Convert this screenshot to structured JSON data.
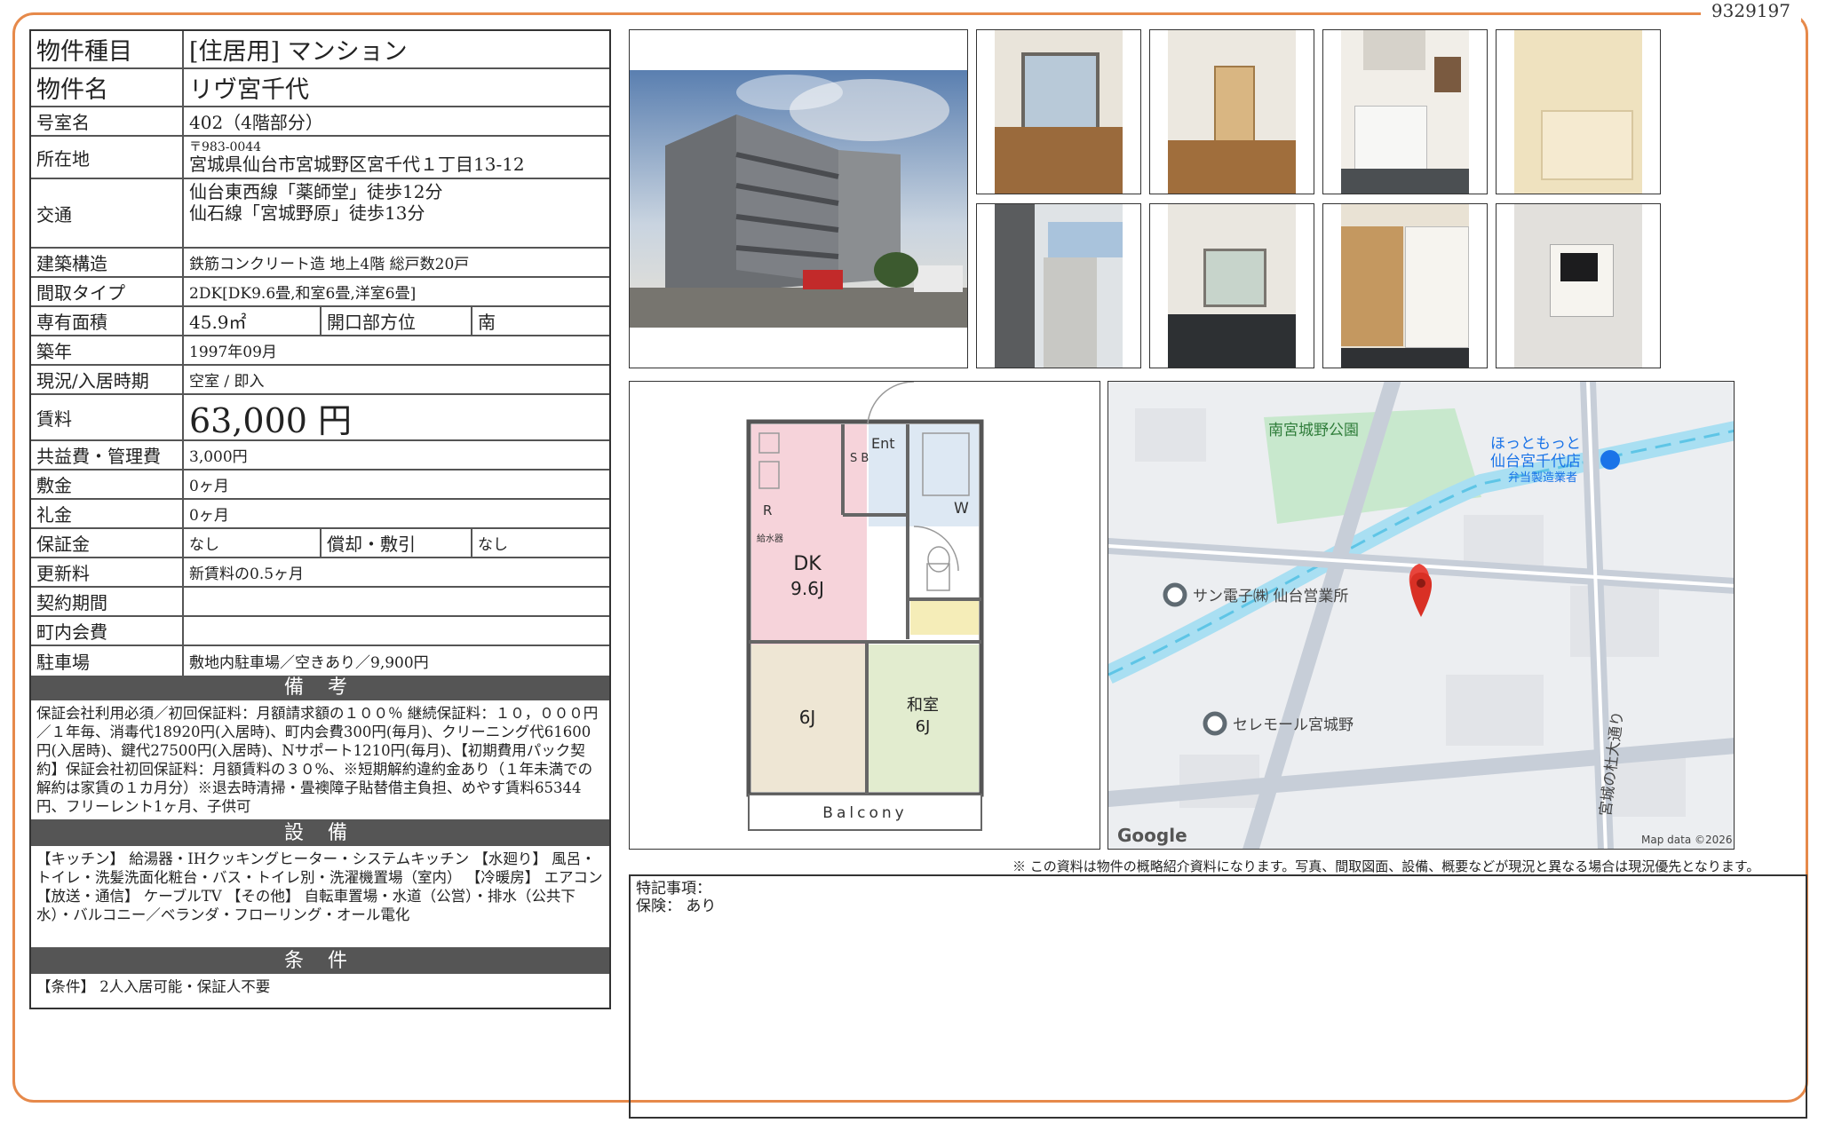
{
  "doc_number": "9329197",
  "property": {
    "type_label": "物件種目",
    "type_value": "[住居用] マンション",
    "name_label": "物件名",
    "name_value": "リヴ宮千代",
    "room_label": "号室名",
    "room_value": "402（4階部分）",
    "address_label": "所在地",
    "postal": "〒983-0044",
    "address_value": "宮城県仙台市宮城野区宮千代１丁目13-12",
    "transit_label": "交通",
    "transit_1": "仙台東西線「薬師堂」徒歩12分",
    "transit_2": "仙石線「宮城野原」徒歩13分",
    "structure_label": "建築構造",
    "structure_value": "鉄筋コンクリート造 地上4階 総戸数20戸",
    "layout_label": "間取タイプ",
    "layout_value": "2DK[DK9.6畳,和室6畳,洋室6畳]",
    "area_label": "専有面積",
    "area_value": "45.9㎡",
    "direction_label": "開口部方位",
    "direction_value": "南",
    "built_label": "築年",
    "built_value": "1997年09月",
    "status_label": "現況/入居時期",
    "status_value": "空室 / 即入",
    "rent_label": "賃料",
    "rent_value": "63,000 円",
    "fee_label": "共益費・管理費",
    "fee_value": "3,000円",
    "deposit_label": "敷金",
    "deposit_value": "0ヶ月",
    "key_money_label": "礼金",
    "key_money_value": "0ヶ月",
    "guarantee_label": "保証金",
    "guarantee_value": "なし",
    "amort_label": "償却・敷引",
    "amort_value": "なし",
    "renewal_label": "更新料",
    "renewal_value": "新賃料の0.5ヶ月",
    "contract_label": "契約期間",
    "contract_value": "",
    "town_label": "町内会費",
    "town_value": "",
    "parking_label": "駐車場",
    "parking_value": "敷地内駐車場／空きあり／9,900円"
  },
  "remarks": {
    "title": "備 考",
    "text": "保証会社利用必須／初回保証料：月額請求額の１００％ 継続保証料：１０，０００円／１年毎、消毒代18920円(入居時)、町内会費300円(毎月)、クリーニング代61600円(入居時)、鍵代27500円(入居時)、Nサポート1210円(毎月)、【初期費用パック契約】保証会社初回保証料：月額賃料の３０%、※短期解約違約金あり（１年未満での解約は家賃の１カ月分）※退去時清掃・畳襖障子貼替借主負担、めやす賃料65344円、フリーレント1ヶ月、子供可"
  },
  "facilities": {
    "title": "設 備",
    "text": "【キッチン】 給湯器・IHクッキングヒーター・システムキッチン 【水廻り】 風呂・トイレ・洗髪洗面化粧台・バス・トイレ別・洗濯機置場（室内） 【冷暖房】 エアコン 【放送・通信】 ケーブルTV 【その他】 自転車置場・水道（公営）・排水（公共下水）・バルコニー／ベランダ・フローリング・オール電化"
  },
  "conditions": {
    "title": "条 件",
    "text": "【条件】 2人入居可能・保証人不要"
  },
  "floorplan": {
    "ent": "Ent",
    "sb": "S B",
    "w": "W",
    "r": "R",
    "water_heater": "給水器",
    "dk": "DK",
    "dk_size": "9.6J",
    "room1": "6J",
    "washitsu": "和室",
    "washitsu_size": "6J",
    "balcony": "Balcony"
  },
  "map": {
    "park": "南宮城野公園",
    "shop1": "ほっともっと",
    "shop2": "仙台宮千代店",
    "shop3": "弁当製造業者",
    "poi1": "サン電子㈱ 仙台営業所",
    "poi2": "セレモール宮城野",
    "street": "宮城の杜大通り",
    "google": "Google",
    "mapdata": "Map data ©2026"
  },
  "notice": "※ この資料は物件の概略紹介資料になります。写真、間取図面、設備、概要などが現況と異なる場合は現況優先となります。",
  "special": {
    "title": "特記事項：",
    "insurance": "保険： あり"
  },
  "colors": {
    "frame": "#e6894a",
    "section": "#555555",
    "dk_pink": "#f6d3da",
    "room_tan": "#eee6d4",
    "room_green": "#e2eccf",
    "map_park": "#c8e8cd",
    "map_water": "#a9dff2"
  }
}
